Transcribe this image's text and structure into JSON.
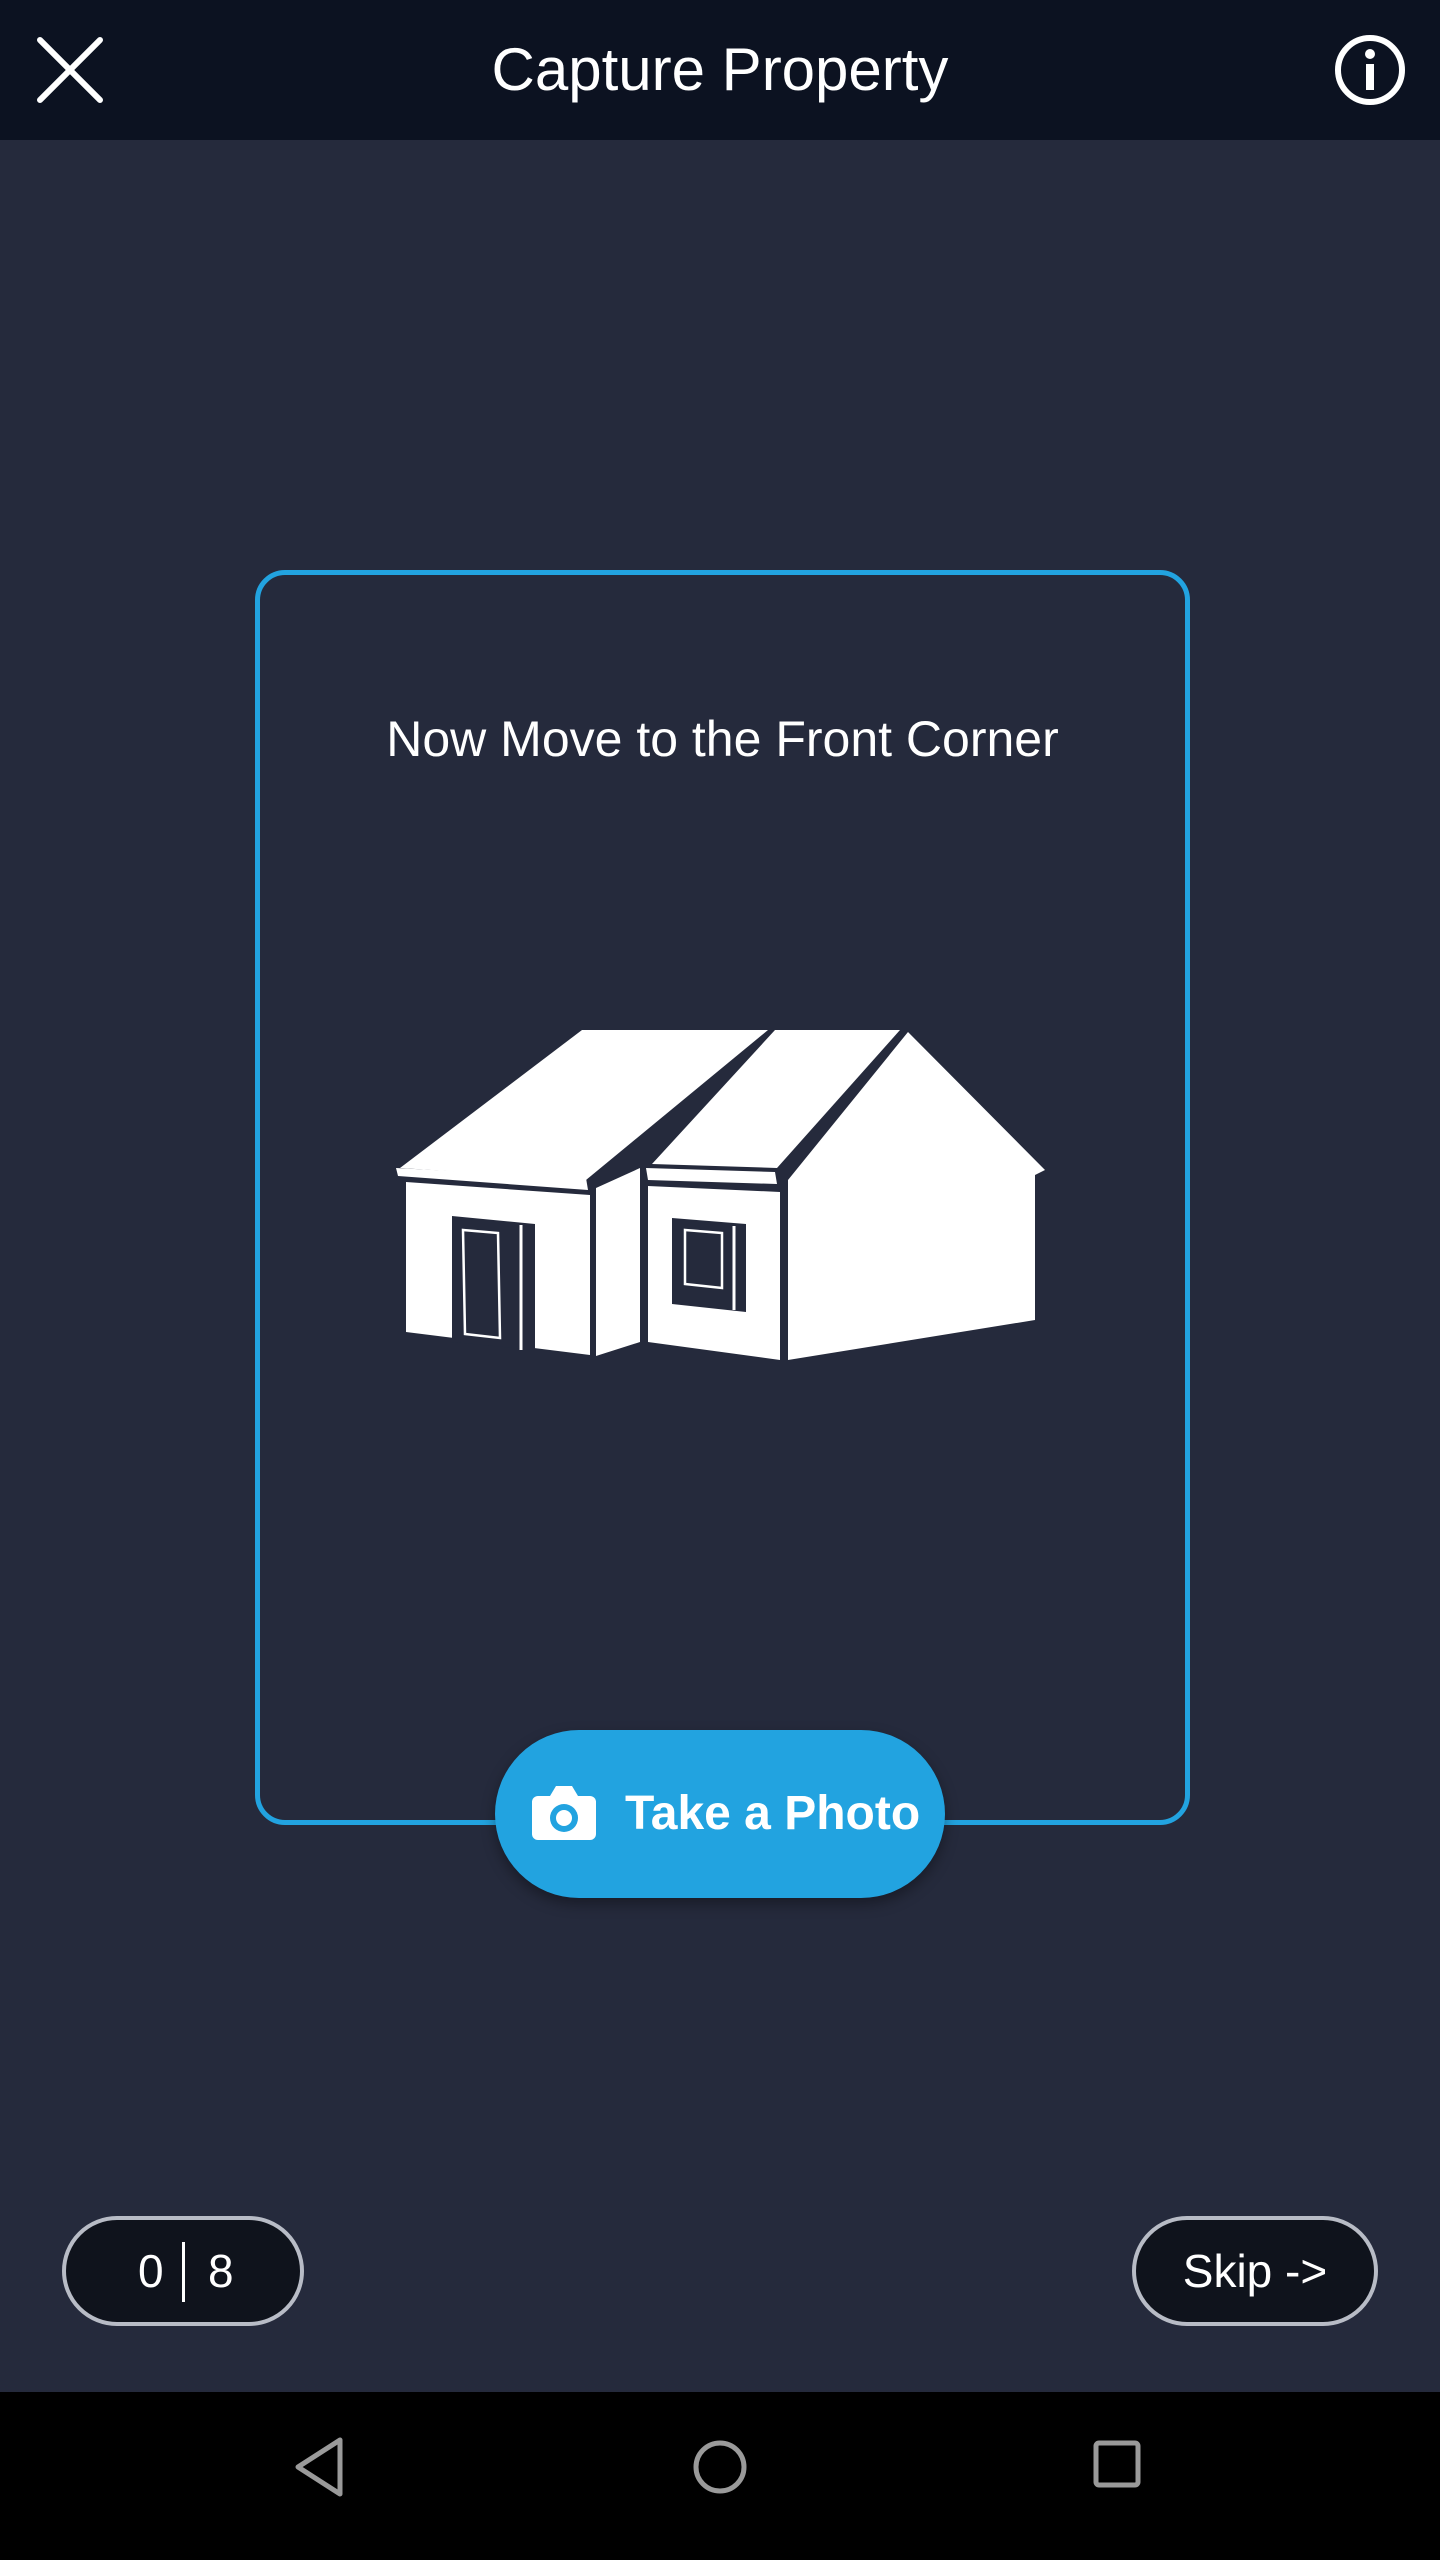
{
  "header": {
    "title": "Capture Property",
    "close_icon": "close-icon",
    "info_icon": "info-icon"
  },
  "capture_card": {
    "instruction": "Now Move to the Front Corner",
    "illustration": "house-front-corner-illustration",
    "frame_color": "#22a3e0"
  },
  "take_photo_button": {
    "label": "Take a Photo",
    "icon": "camera-icon",
    "color": "#22a3e0"
  },
  "progress": {
    "current": "0",
    "total": "8"
  },
  "skip_button": {
    "label": "Skip ->"
  },
  "system_nav": {
    "back_icon": "nav-back-icon",
    "home_icon": "nav-home-icon",
    "recents_icon": "nav-recents-icon"
  },
  "colors": {
    "background": "#252a3c",
    "topbar": "#0c1221",
    "accent": "#22a3e0"
  }
}
